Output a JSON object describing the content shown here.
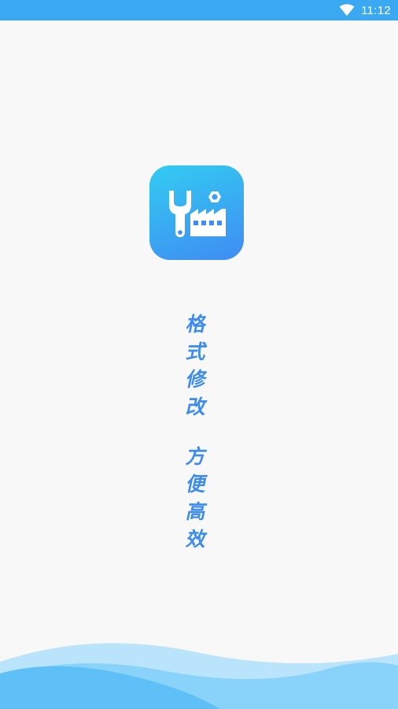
{
  "status_bar": {
    "time": "11:12",
    "wifi_icon": "wifi-icon",
    "background": "#3aa9f2"
  },
  "app": {
    "icon": "wrench-nut-factory-icon",
    "icon_gradient": [
      "#33ccf2",
      "#3f8cf2"
    ]
  },
  "slogan": {
    "line1": [
      "格",
      "式",
      "修",
      "改"
    ],
    "line2": [
      "方",
      "便",
      "高",
      "效"
    ],
    "color": "#3c8cef"
  },
  "decoration": {
    "wave_colors": [
      "#5fc0f7",
      "#89d2fa",
      "#b9e4fb"
    ]
  }
}
